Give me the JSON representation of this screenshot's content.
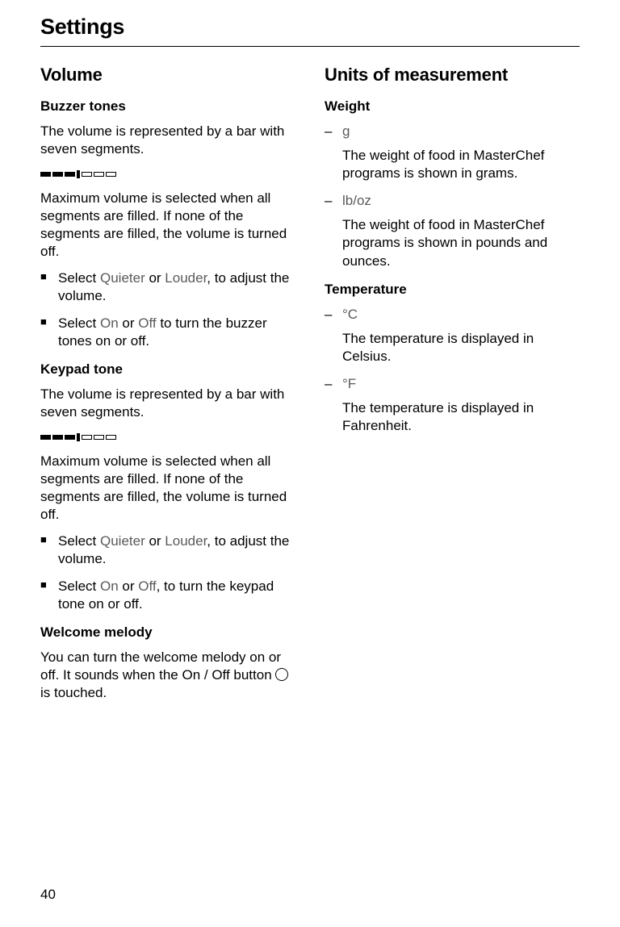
{
  "header": "Settings",
  "pageNumber": "40",
  "left": {
    "heading": "Volume",
    "buzzer": {
      "heading": "Buzzer tones",
      "intro": "The volume is represented by a bar with seven segments.",
      "maxNote": "Maximum volume is selected when all segments are filled. If none of the segments are filled, the volume is turned off.",
      "step1_a": "Select ",
      "step1_opt1": "Quieter",
      "step1_b": " or ",
      "step1_opt2": "Louder",
      "step1_c": ", to adjust the volume.",
      "step2_a": "Select ",
      "step2_opt1": "On",
      "step2_b": " or ",
      "step2_opt2": "Off",
      "step2_c": " to turn the buzzer tones on or off."
    },
    "keypad": {
      "heading": "Keypad tone",
      "intro": "The volume is represented by a bar with seven segments.",
      "maxNote": "Maximum volume is selected when all segments are filled. If none of the segments are filled, the volume is turned off.",
      "step1_a": "Select ",
      "step1_opt1": "Quieter",
      "step1_b": " or ",
      "step1_opt2": "Louder",
      "step1_c": ", to adjust the volume.",
      "step2_a": "Select ",
      "step2_opt1": "On",
      "step2_b": " or ",
      "step2_opt2": "Off",
      "step2_c": ", to turn the keypad tone on or off."
    },
    "welcome": {
      "heading": "Welcome melody",
      "text_a": "You can turn the welcome melody on or off. It sounds when the On / Off button ",
      "text_b": " is touched."
    }
  },
  "right": {
    "heading": "Units of measurement",
    "weight": {
      "heading": "Weight",
      "opt1_label": "g",
      "opt1_desc": "The weight of food in MasterChef programs is shown in grams.",
      "opt2_label": "lb/oz",
      "opt2_desc": "The weight of food in MasterChef programs is shown in pounds and ounces."
    },
    "temperature": {
      "heading": "Temperature",
      "opt1_label": "°C",
      "opt1_desc": "The temperature is displayed in Celsius.",
      "opt2_label": "°F",
      "opt2_desc": "The temperature is displayed in Fahrenheit."
    }
  }
}
